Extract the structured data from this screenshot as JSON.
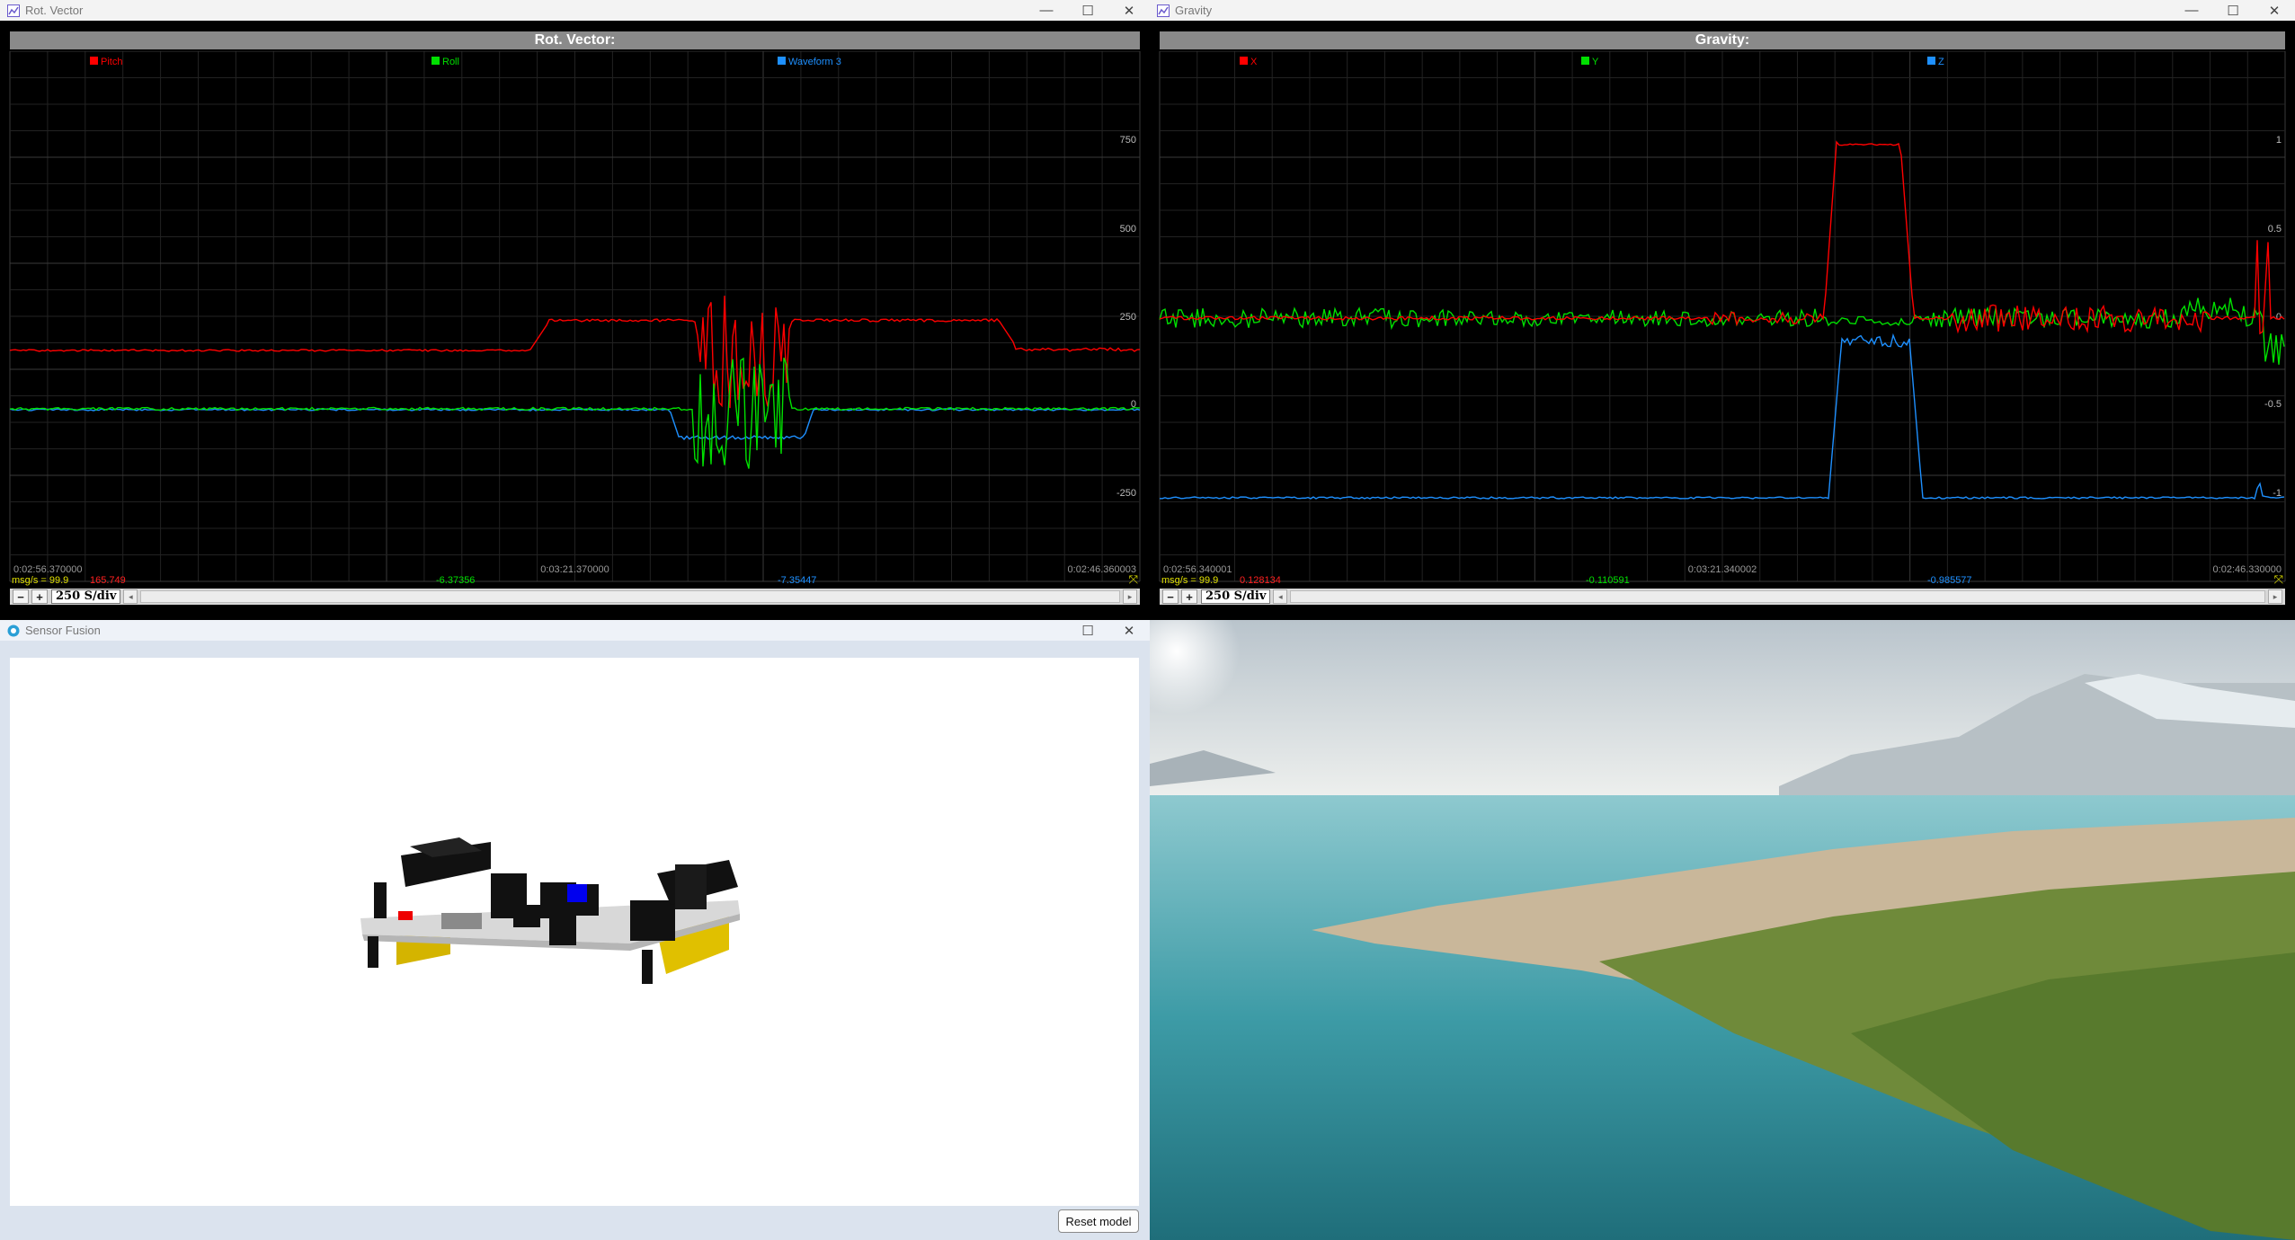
{
  "windows": {
    "rot_vector": {
      "title": "Rot. Vector",
      "header": "Rot. Vector:",
      "legend": [
        {
          "label": "Pitch",
          "color": "#ff0000"
        },
        {
          "label": "Roll",
          "color": "#00e000"
        },
        {
          "label": "Waveform 3",
          "color": "#1e90ff"
        }
      ],
      "y_ticks": [
        "750",
        "500",
        "250",
        "0",
        "-250"
      ],
      "time_labels": [
        "0:02:56.370000",
        "0:03:21.370000",
        "0:02:46.360003"
      ],
      "readouts": {
        "rate": "msg/s = 99.9",
        "pitch": "165.749",
        "roll": "-6.37356",
        "wave3": "-7.35447"
      },
      "sample_div": "250 S/div"
    },
    "gravity": {
      "title": "Gravity",
      "header": "Gravity:",
      "legend": [
        {
          "label": "X",
          "color": "#ff0000"
        },
        {
          "label": "Y",
          "color": "#00e000"
        },
        {
          "label": "Z",
          "color": "#1e90ff"
        }
      ],
      "y_ticks": [
        "1",
        "0.5",
        "0",
        "-0.5",
        "-1"
      ],
      "time_labels": [
        "0:02:56.340001",
        "0:03:21.340002",
        "0:02:46.330000"
      ],
      "readouts": {
        "rate": "msg/s = 99.9",
        "x": "0.128134",
        "y": "-0.110591",
        "z": "-0.985577"
      },
      "sample_div": "250 S/div"
    },
    "sensor_fusion": {
      "title": "Sensor Fusion",
      "reset_label": "Reset model"
    }
  },
  "window_controls": {
    "minimize": "—",
    "maximize": "☐",
    "close": "✕"
  }
}
